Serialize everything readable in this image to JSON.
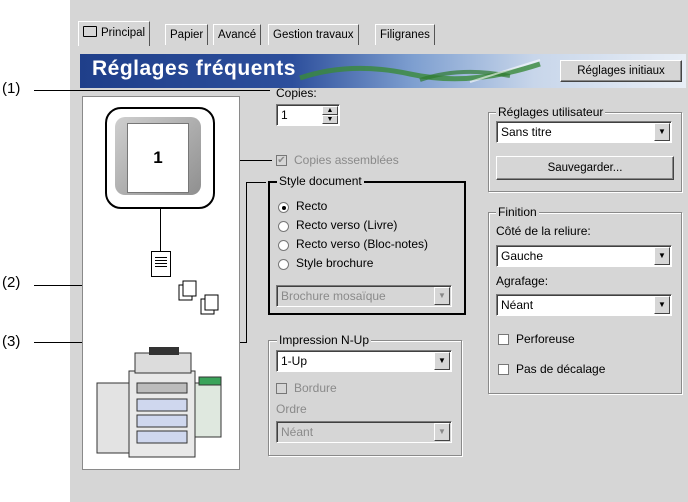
{
  "tabs": [
    "Principal",
    "Papier",
    "Avancé",
    "Gestion travaux",
    "Filigranes"
  ],
  "banner": {
    "title": "Réglages fréquents",
    "reset_button": "Réglages initiaux"
  },
  "callouts": [
    "(1)",
    "(2)",
    "(3)"
  ],
  "preview": {
    "page_number": "1"
  },
  "copies": {
    "label": "Copies:",
    "value": "1"
  },
  "collate": {
    "label": "Copies assemblées",
    "checked": true,
    "disabled": true
  },
  "style_document": {
    "title": "Style document",
    "options": [
      "Recto",
      "Recto verso (Livre)",
      "Recto verso (Bloc-notes)",
      "Style brochure"
    ],
    "selected": 0,
    "booklet_value": "Brochure mosaïque"
  },
  "nup": {
    "title": "Impression N-Up",
    "value": "1-Up",
    "border_label": "Bordure",
    "order_label": "Ordre",
    "order_value": "Néant"
  },
  "user_settings": {
    "title": "Réglages utilisateur",
    "value": "Sans titre",
    "save_button": "Sauvegarder..."
  },
  "finishing": {
    "title": "Finition",
    "binding_label": "Côté de la reliure:",
    "binding_value": "Gauche",
    "staple_label": "Agrafage:",
    "staple_value": "Néant",
    "punch_label": "Perforeuse",
    "offset_label": "Pas de décalage"
  }
}
